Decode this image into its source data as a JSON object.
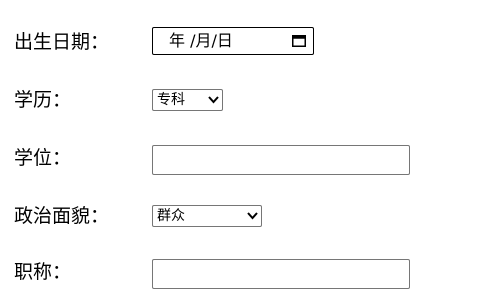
{
  "form": {
    "birthdate": {
      "label": "出生日期：",
      "display": "年 /月/日",
      "icon": "calendar-icon"
    },
    "education": {
      "label": "学历：",
      "selected": "专科",
      "icon": "chevron-down-icon"
    },
    "degree": {
      "label": "学位：",
      "value": ""
    },
    "political_status": {
      "label": "政治面貌：",
      "selected": "群众",
      "icon": "chevron-down-icon"
    },
    "title": {
      "label": "职称：",
      "value": ""
    }
  },
  "colors": {
    "border": "#767676",
    "date_border": "#000000",
    "text": "#000000",
    "background": "#ffffff"
  }
}
